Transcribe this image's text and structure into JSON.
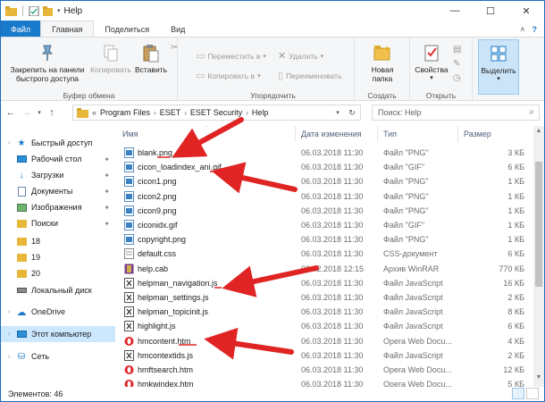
{
  "window": {
    "title": "Help"
  },
  "ribbon_tabs": [
    {
      "label": "Файл"
    },
    {
      "label": "Главная"
    },
    {
      "label": "Поделиться"
    },
    {
      "label": "Вид"
    }
  ],
  "ribbon": {
    "clipboard": {
      "label": "Буфер обмена",
      "pin": "Закрепить на панели быстрого доступа",
      "copy": "Копировать",
      "paste": "Вставить"
    },
    "organize": {
      "label": "Упорядочить",
      "move_to": "Переместить в",
      "copy_to": "Копировать в",
      "delete": "Удалить",
      "rename": "Переименовать"
    },
    "create": {
      "label": "Создать",
      "new_folder": "Новая папка"
    },
    "open": {
      "label": "Открыть",
      "properties": "Свойства"
    },
    "select": {
      "label": "Выделить"
    }
  },
  "address": {
    "prefix": "«",
    "crumbs": [
      "Program Files",
      "ESET",
      "ESET Security",
      "Help"
    ]
  },
  "search": {
    "placeholder": "Поиск: Help"
  },
  "nav": {
    "items": [
      {
        "label": "Быстрый доступ",
        "icon": "star-icon",
        "pinned": false
      },
      {
        "label": "Рабочий стол",
        "icon": "desktop-icon",
        "pinned": true
      },
      {
        "label": "Загрузки",
        "icon": "download-icon",
        "pinned": true
      },
      {
        "label": "Документы",
        "icon": "documents-icon",
        "pinned": true
      },
      {
        "label": "Изображения",
        "icon": "pictures-icon",
        "pinned": true
      },
      {
        "label": "Поиски",
        "icon": "search-folder-icon",
        "pinned": true
      },
      {
        "label": "18",
        "icon": "folder-icon",
        "pinned": false
      },
      {
        "label": "19",
        "icon": "folder-icon",
        "pinned": false
      },
      {
        "label": "20",
        "icon": "folder-icon",
        "pinned": false
      },
      {
        "label": "Локальный диск",
        "icon": "drive-icon",
        "pinned": false
      },
      {
        "label": "OneDrive",
        "icon": "onedrive-icon",
        "pinned": false
      },
      {
        "label": "Этот компьютер",
        "icon": "computer-icon",
        "pinned": false
      },
      {
        "label": "Сеть",
        "icon": "network-icon",
        "pinned": false
      }
    ]
  },
  "columns": {
    "name": "Имя",
    "date": "Дата изменения",
    "type": "Тип",
    "size": "Размер"
  },
  "files": [
    {
      "name": "blank.png",
      "date": "06.03.2018 11:30",
      "type": "Файл \"PNG\"",
      "size": "3 КБ",
      "icon": "png-icon"
    },
    {
      "name": "cicon_loadindex_ani.gif",
      "date": "06.03.2018 11:30",
      "type": "Файл \"GIF\"",
      "size": "6 КБ",
      "icon": "gif-icon"
    },
    {
      "name": "cicon1.png",
      "date": "06.03.2018 11:30",
      "type": "Файл \"PNG\"",
      "size": "1 КБ",
      "icon": "png-icon"
    },
    {
      "name": "cicon2.png",
      "date": "06.03.2018 11:30",
      "type": "Файл \"PNG\"",
      "size": "1 КБ",
      "icon": "png-icon"
    },
    {
      "name": "cicon9.png",
      "date": "06.03.2018 11:30",
      "type": "Файл \"PNG\"",
      "size": "1 КБ",
      "icon": "png-icon"
    },
    {
      "name": "ciconidx.gif",
      "date": "06.03.2018 11:30",
      "type": "Файл \"GIF\"",
      "size": "1 КБ",
      "icon": "gif-icon"
    },
    {
      "name": "copyright.png",
      "date": "06.03.2018 11:30",
      "type": "Файл \"PNG\"",
      "size": "1 КБ",
      "icon": "png-icon"
    },
    {
      "name": "default.css",
      "date": "06.03.2018 11:30",
      "type": "CSS-документ",
      "size": "6 КБ",
      "icon": "css-icon"
    },
    {
      "name": "help.cab",
      "date": "08.02.2018 12:15",
      "type": "Архив WinRAR",
      "size": "770 КБ",
      "icon": "archive-icon"
    },
    {
      "name": "helpman_navigation.js",
      "date": "06.03.2018 11:30",
      "type": "Файл JavaScript",
      "size": "16 КБ",
      "icon": "js-icon"
    },
    {
      "name": "helpman_settings.js",
      "date": "06.03.2018 11:30",
      "type": "Файл JavaScript",
      "size": "2 КБ",
      "icon": "js-icon"
    },
    {
      "name": "helpman_topicinit.js",
      "date": "06.03.2018 11:30",
      "type": "Файл JavaScript",
      "size": "8 КБ",
      "icon": "js-icon"
    },
    {
      "name": "highlight.js",
      "date": "06.03.2018 11:30",
      "type": "Файл JavaScript",
      "size": "6 КБ",
      "icon": "js-icon"
    },
    {
      "name": "hmcontent.htm",
      "date": "06.03.2018 11:30",
      "type": "Opera Web Docu...",
      "size": "4 КБ",
      "icon": "opera-icon"
    },
    {
      "name": "hmcontextids.js",
      "date": "06.03.2018 11:30",
      "type": "Файл JavaScript",
      "size": "2 КБ",
      "icon": "js-icon"
    },
    {
      "name": "hmftsearch.htm",
      "date": "06.03.2018 11:30",
      "type": "Opera Web Docu...",
      "size": "12 КБ",
      "icon": "opera-icon"
    },
    {
      "name": "hmkwindex.htm",
      "date": "06.03.2018 11:30",
      "type": "Opera Web Docu...",
      "size": "5 КБ",
      "icon": "opera-icon"
    }
  ],
  "status": {
    "count": "Элементов: 46"
  },
  "colors": {
    "accent": "#1979ca",
    "annotation": "#e02424",
    "selected": "#cce8ff"
  }
}
